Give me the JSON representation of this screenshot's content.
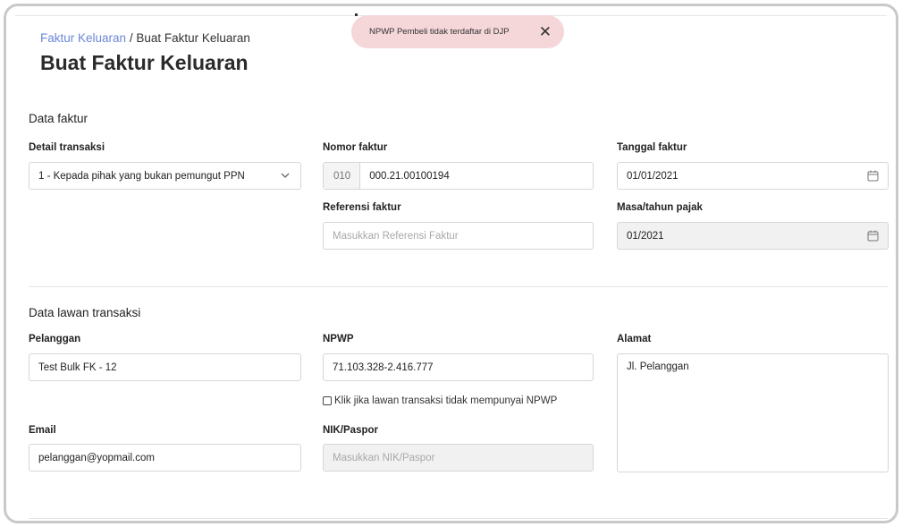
{
  "toast": {
    "message": "NPWP Pembeli tidak terdaftar di DJP",
    "close_glyph": "✕"
  },
  "breadcrumb": {
    "parent": "Faktur Keluaran",
    "separator": "/",
    "current": "Buat Faktur Keluaran"
  },
  "page_title": "Buat Faktur Keluaran",
  "data_faktur": {
    "title": "Data faktur",
    "detail_transaksi": {
      "label": "Detail transaksi",
      "value": "1 - Kepada pihak yang bukan pemungut PPN",
      "icon": "chevron-down-icon"
    },
    "nomor_faktur": {
      "label": "Nomor faktur",
      "prefix": "010",
      "value": "000.21.00100194"
    },
    "tanggal_faktur": {
      "label": "Tanggal faktur",
      "value": "01/01/2021",
      "icon": "calendar-icon"
    },
    "referensi_faktur": {
      "label": "Referensi faktur",
      "placeholder": "Masukkan Referensi Faktur"
    },
    "masa_tahun_pajak": {
      "label": "Masa/tahun pajak",
      "value": "01/2021",
      "icon": "calendar-icon"
    }
  },
  "data_lawan": {
    "title": "Data lawan transaksi",
    "pelanggan": {
      "label": "Pelanggan",
      "value": "Test Bulk FK - 12"
    },
    "npwp": {
      "label": "NPWP",
      "value": "71.103.328-2.416.777"
    },
    "no_npwp_checkbox": {
      "label": "Klik jika lawan transaksi tidak mempunyai NPWP"
    },
    "alamat": {
      "label": "Alamat",
      "value": "Jl. Pelanggan"
    },
    "email": {
      "label": "Email",
      "value": "pelanggan@yopmail.com"
    },
    "nik_paspor": {
      "label": "NIK/Paspor",
      "placeholder": "Masukkan NIK/Paspor"
    }
  },
  "colors": {
    "link": "#6b86d6",
    "toast_bg": "#f5d6d9",
    "border": "#d6d6d6",
    "disabled_bg": "#f1f1f1"
  }
}
